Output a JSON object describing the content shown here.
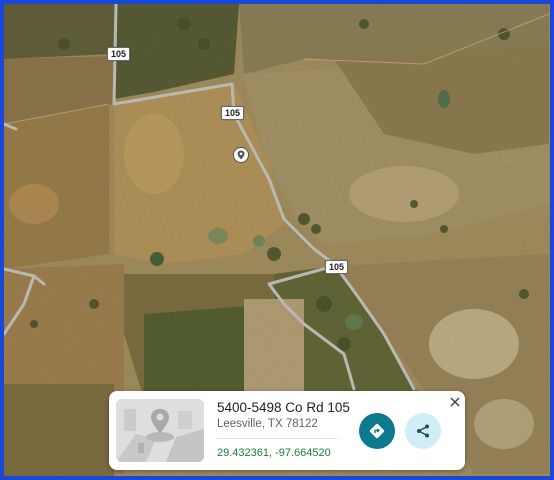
{
  "map": {
    "road_labels": {
      "top_left": "105",
      "center": "105",
      "right": "105"
    },
    "colors": {
      "road": "#b9b9b4",
      "field_dry": "#b89c63",
      "field_green": "#4e5a2b",
      "water": "#6a7f5a"
    }
  },
  "place_card": {
    "title": "5400-5498 Co Rd 105",
    "subtitle": "Leesville, TX 78122",
    "coordinates": "29.432361, -97.664520",
    "directions_icon": "directions-icon",
    "share_icon": "share-icon",
    "close_icon": "close-icon",
    "accent_color": "#0b7a8e"
  }
}
